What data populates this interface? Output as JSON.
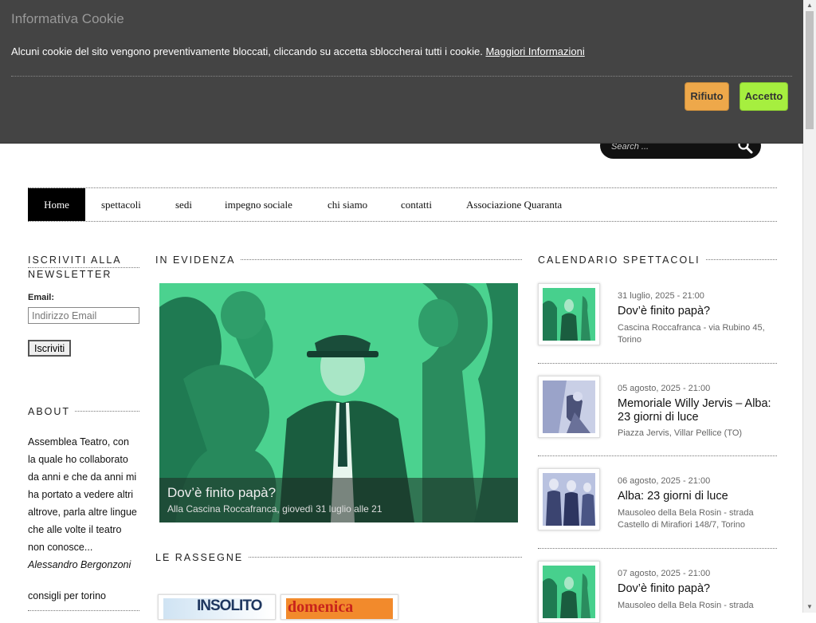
{
  "cookie": {
    "title": "Informativa Cookie",
    "message": "Alcuni cookie del sito vengono preventivamente bloccati, cliccando su accetta sbloccherai tutti i cookie.",
    "more_link": "Maggiori Informazioni",
    "reject_label": "Rifiuto",
    "accept_label": "Accetto",
    "reject_color": "#eea84a",
    "accept_color": "#a6ef3f"
  },
  "search": {
    "placeholder": "Search ..."
  },
  "nav": {
    "items": [
      "Home",
      "spettacoli",
      "sedi",
      "impegno sociale",
      "chi siamo",
      "contatti",
      "Associazione Quaranta"
    ],
    "active": "Home"
  },
  "newsletter": {
    "title": "Iscriviti alla newsletter",
    "email_label": "Email:",
    "email_placeholder": "Indirizzo Email",
    "submit_label": "Iscriviti"
  },
  "about": {
    "title": "About",
    "quote": "Assemblea Teatro, con la quale ho collaborato da anni e che da anni mi ha portato a vedere altri altrove, parla altre lingue che alle volte il teatro non conosce...",
    "author": "Alessandro Bergonzoni",
    "next_title": "consigli per torino"
  },
  "featured": {
    "section_title": "In evidenza",
    "title": "Dov’è finito papà?",
    "subtitle": "Alla Cascina Roccafranca, giovedì 31 luglio alle 21",
    "bg_color": "#47d08d"
  },
  "rassegne": {
    "title": "Le rassegne",
    "items": [
      "INSOLITO",
      "domenica"
    ]
  },
  "calendar": {
    "title": "Calendario spettacoli",
    "events": [
      {
        "date": "31 luglio, 2025 - 21:00",
        "title": "Dov’è finito papà?",
        "place": "Cascina Roccafranca - via Rubino 45, Torino"
      },
      {
        "date": "05 agosto, 2025 - 21:00",
        "title": "Memoriale Willy Jervis – Alba: 23 giorni di luce",
        "place": "Piazza Jervis, Villar Pellice (TO)"
      },
      {
        "date": "06 agosto, 2025 - 21:00",
        "title": "Alba: 23 giorni di luce",
        "place": "Mausoleo della Bela Rosin - strada Castello di Mirafiori 148/7, Torino"
      },
      {
        "date": "07 agosto, 2025 - 21:00",
        "title": "Dov’è finito papà?",
        "place": "Mausoleo della Bela Rosin - strada"
      }
    ]
  }
}
